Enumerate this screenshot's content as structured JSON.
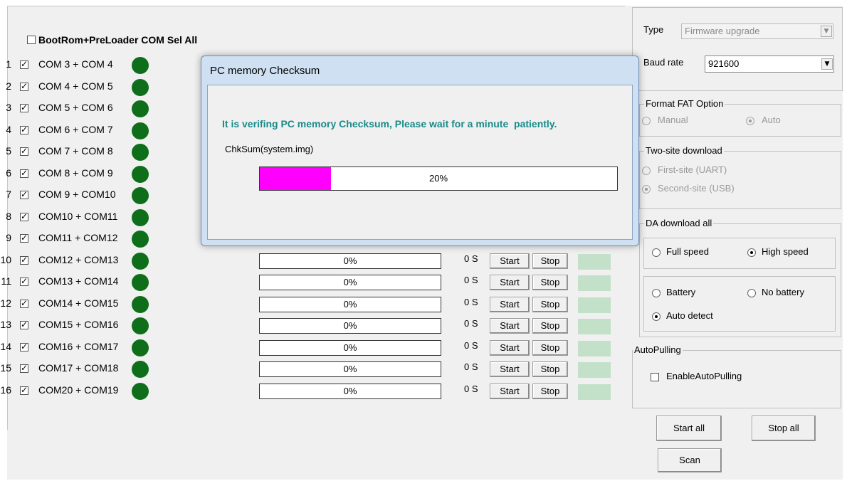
{
  "header": {
    "sel_all_label": "BootRom+PreLoader COM Sel All",
    "sel_all_checked": false
  },
  "rows": [
    {
      "index": "1",
      "port": "COM 3 + COM 4",
      "checked": true
    },
    {
      "index": "2",
      "port": "COM 4 + COM 5",
      "checked": true
    },
    {
      "index": "3",
      "port": "COM 5 + COM 6",
      "checked": true
    },
    {
      "index": "4",
      "port": "COM 6 + COM 7",
      "checked": true
    },
    {
      "index": "5",
      "port": "COM 7 + COM 8",
      "checked": true
    },
    {
      "index": "6",
      "port": "COM 8 + COM 9",
      "checked": true
    },
    {
      "index": "7",
      "port": "COM 9 + COM10",
      "checked": true
    },
    {
      "index": "8",
      "port": "COM10 + COM11",
      "checked": true
    },
    {
      "index": "9",
      "port": "COM11 + COM12",
      "checked": true
    },
    {
      "index": "10",
      "port": "COM12 + COM13",
      "checked": true,
      "progress": "0%",
      "time": "0 S",
      "start": "Start",
      "stop": "Stop"
    },
    {
      "index": "11",
      "port": "COM13 + COM14",
      "checked": true,
      "progress": "0%",
      "time": "0 S",
      "start": "Start",
      "stop": "Stop"
    },
    {
      "index": "12",
      "port": "COM14 + COM15",
      "checked": true,
      "progress": "0%",
      "time": "0 S",
      "start": "Start",
      "stop": "Stop"
    },
    {
      "index": "13",
      "port": "COM15 + COM16",
      "checked": true,
      "progress": "0%",
      "time": "0 S",
      "start": "Start",
      "stop": "Stop"
    },
    {
      "index": "14",
      "port": "COM16 + COM17",
      "checked": true,
      "progress": "0%",
      "time": "0 S",
      "start": "Start",
      "stop": "Stop"
    },
    {
      "index": "15",
      "port": "COM17 + COM18",
      "checked": true,
      "progress": "0%",
      "time": "0 S",
      "start": "Start",
      "stop": "Stop"
    },
    {
      "index": "16",
      "port": "COM20 + COM19",
      "checked": true,
      "progress": "0%",
      "time": "0 S",
      "start": "Start",
      "stop": "Stop"
    }
  ],
  "colors": {
    "led": "#0f6e1a",
    "status_cell": "#c3e1c8",
    "dialog_fill": "#ff00ff",
    "dialog_message": "#1a8a8a"
  },
  "settings": {
    "type_label": "Type",
    "type_value": "Firmware upgrade",
    "baud_label": "Baud rate",
    "baud_value": "921600",
    "format_fat": {
      "title": "Format FAT Option",
      "options": [
        "Manual",
        "Auto"
      ],
      "selected": "Auto"
    },
    "two_site": {
      "title": "Two-site download",
      "options": [
        "First-site (UART)",
        "Second-site (USB)"
      ],
      "selected": "Second-site (USB)"
    },
    "da_download": {
      "title": "DA download all",
      "options": [
        "Full speed",
        "High speed"
      ],
      "selected": "High speed"
    },
    "battery": {
      "options": [
        "Battery",
        "No battery",
        "Auto detect"
      ],
      "selected": "Auto detect"
    },
    "auto_pulling": {
      "title": "AutoPulling",
      "checkbox_label": "EnableAutoPulling",
      "checked": false
    },
    "start_all": "Start all",
    "stop_all": "Stop all",
    "scan": "Scan"
  },
  "dialog": {
    "title": "PC memory Checksum",
    "message": "It is verifing PC memory Checksum, Please wait for a minute  patiently.",
    "file": "ChkSum(system.img)",
    "progress_fraction": 0.2,
    "progress_label": "20%"
  }
}
